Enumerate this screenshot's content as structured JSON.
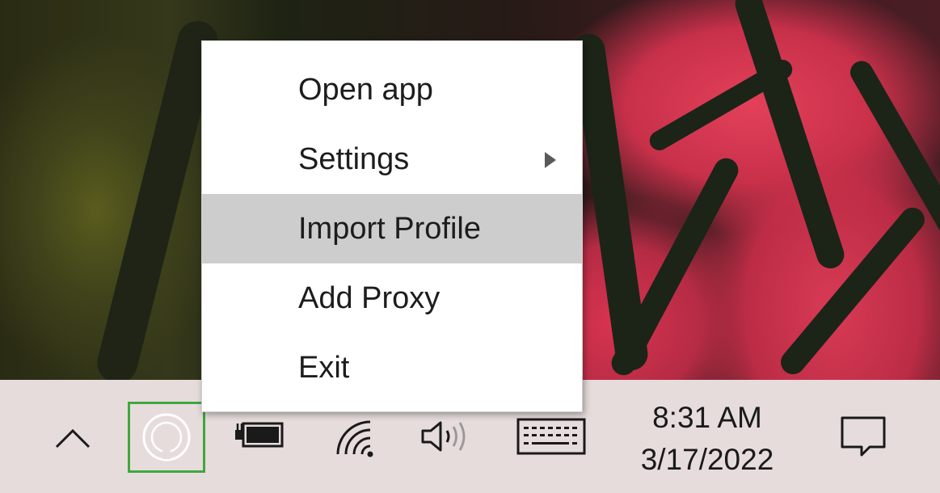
{
  "menu": {
    "items": [
      {
        "label": "Open app",
        "has_submenu": false,
        "highlighted": false
      },
      {
        "label": "Settings",
        "has_submenu": true,
        "highlighted": false
      },
      {
        "label": "Import Profile",
        "has_submenu": false,
        "highlighted": true
      },
      {
        "label": "Add Proxy",
        "has_submenu": false,
        "highlighted": false
      },
      {
        "label": "Exit",
        "has_submenu": false,
        "highlighted": false
      }
    ],
    "highlight_color": "#cdcdcd"
  },
  "taskbar": {
    "icons": [
      "chevron-up-icon",
      "app-tray-icon",
      "battery-icon",
      "wifi-icon",
      "volume-icon",
      "keyboard-icon",
      "notification-icon"
    ],
    "highlight_box_color": "#3fa83f",
    "clock": {
      "time": "8:31 AM",
      "date": "3/17/2022"
    }
  }
}
